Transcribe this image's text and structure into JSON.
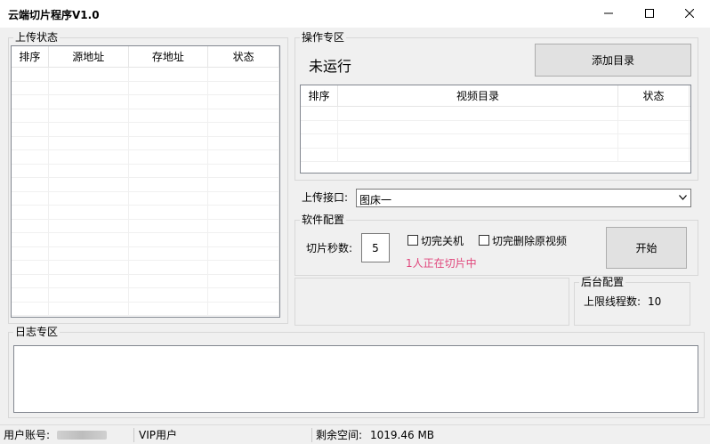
{
  "window": {
    "title": "云端切片程序V1.0"
  },
  "upload_status": {
    "label": "上传状态",
    "columns": [
      "排序",
      "源地址",
      "存地址",
      "状态"
    ]
  },
  "ops": {
    "label": "操作专区",
    "run_status": "未运行",
    "add_dir_button": "添加目录",
    "columns": [
      "排序",
      "视频目录",
      "状态"
    ]
  },
  "upload_api": {
    "label": "上传接口:",
    "selected": "图床一"
  },
  "software_config": {
    "label": "软件配置",
    "slice_seconds_label": "切片秒数:",
    "slice_seconds_value": "5",
    "shutdown_label": "切完关机",
    "delete_source_label": "切完删除原视频",
    "slicing_status": "1人正在切片中",
    "slicing_status_color": "#e0457b",
    "start_button": "开始"
  },
  "backend_config": {
    "label": "后台配置",
    "max_threads_label": "上限线程数:",
    "max_threads_value": "10"
  },
  "log": {
    "label": "日志专区"
  },
  "statusbar": {
    "account_label": "用户账号:",
    "vip_label": "VIP用户",
    "space_label": "剩余空间:",
    "space_value": "1019.46 MB"
  }
}
